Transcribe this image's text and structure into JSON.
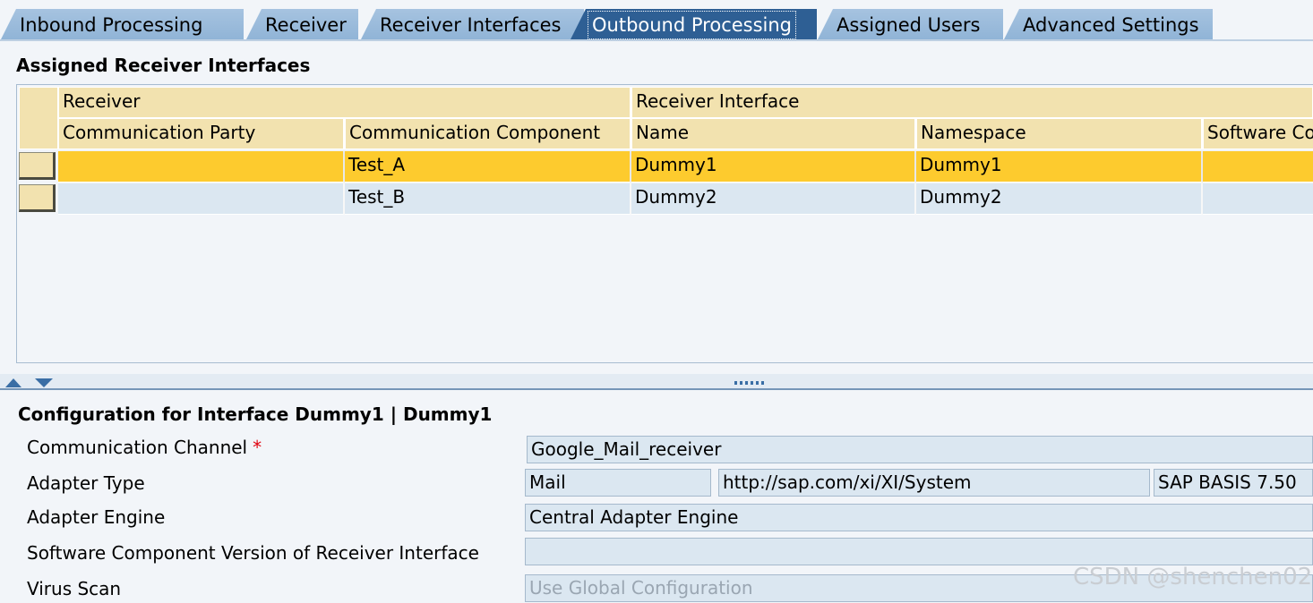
{
  "tabs": [
    {
      "label": "Inbound Processing",
      "active": false
    },
    {
      "label": "Receiver",
      "active": false
    },
    {
      "label": "Receiver Interfaces",
      "active": false
    },
    {
      "label": "Outbound Processing",
      "active": true
    },
    {
      "label": "Assigned Users",
      "active": false
    },
    {
      "label": "Advanced Settings",
      "active": false
    }
  ],
  "assigned_section": {
    "title": "Assigned Receiver Interfaces",
    "group_headers": {
      "receiver": "Receiver",
      "receiver_interface": "Receiver Interface"
    },
    "columns": [
      "Communication Party",
      "Communication Component",
      "Name",
      "Namespace",
      "Software Co"
    ],
    "rows": [
      {
        "party": "",
        "component": "Test_A",
        "name": "Dummy1",
        "namespace": "Dummy1",
        "software": "",
        "selected": true
      },
      {
        "party": "",
        "component": "Test_B",
        "name": "Dummy2",
        "namespace": "Dummy2",
        "software": "",
        "selected": false
      }
    ]
  },
  "config_section": {
    "title": "Configuration for Interface Dummy1 | Dummy1",
    "labels": {
      "communication_channel": "Communication Channel",
      "required_marker": "*",
      "adapter_type": "Adapter Type",
      "adapter_engine": "Adapter Engine",
      "software_component_version": "Software Component Version of Receiver Interface",
      "virus_scan": "Virus Scan"
    },
    "values": {
      "communication_channel": "Google_Mail_receiver",
      "adapter_type": "Mail",
      "adapter_namespace": "http://sap.com/xi/XI/System",
      "adapter_swcv": "SAP BASIS 7.50",
      "adapter_engine": "Central Adapter Engine",
      "software_component_version": "",
      "virus_scan": "Use Global Configuration"
    }
  },
  "watermark": "CSDN @shenchen02",
  "colors": {
    "tab_active": "#2e5f94",
    "tab_inactive": "#a6c3e0",
    "table_header": "#f2e2af",
    "row_selected": "#fdcb2e",
    "row_normal": "#dbe7f1",
    "required": "#e0000d"
  }
}
